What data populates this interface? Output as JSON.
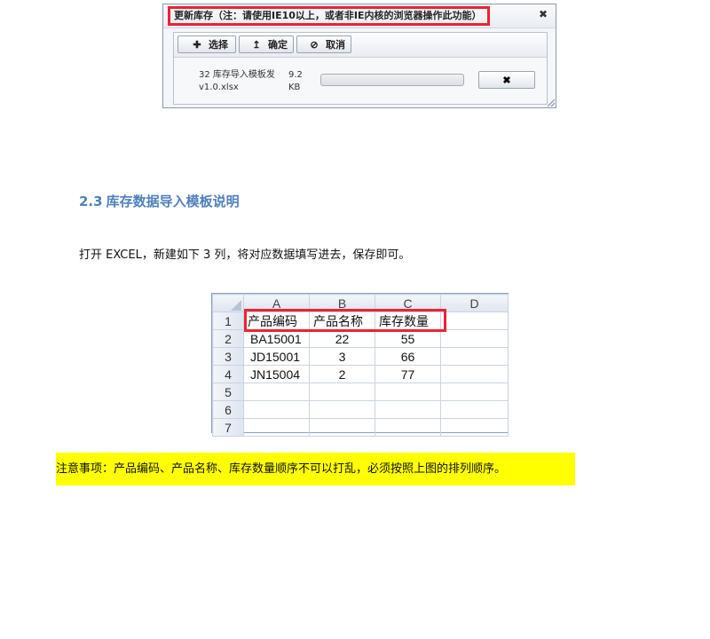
{
  "dialog": {
    "title": "更新库存（注：请使用IE10以上，或者非IE内核的浏览器操作此功能）",
    "close_icon": "close-icon",
    "close_glyph": "✖",
    "toolbar": {
      "select_label": "选择",
      "select_icon": "plus-icon",
      "select_glyph": "✚",
      "confirm_label": "确定",
      "confirm_icon": "upload-icon",
      "confirm_glyph": "↥",
      "cancel_label": "取消",
      "cancel_icon": "cancel-icon",
      "cancel_glyph": "⊘"
    },
    "file": {
      "name": "32 库存导入模板发v1.0.xlsx",
      "size": "9.2 KB",
      "progress": 0,
      "remove_icon": "close-icon",
      "remove_glyph": "✖"
    }
  },
  "section": {
    "number": "2.3",
    "title": "库存数据导入模板说明"
  },
  "instruction": "打开 EXCEL，新建如下 3 列，将对应数据填写进去，保存即可。",
  "spreadsheet": {
    "columns": [
      "A",
      "B",
      "C",
      "D"
    ],
    "rows": [
      {
        "num": "1",
        "cells": [
          "产品编码",
          "产品名称",
          "库存数量",
          ""
        ]
      },
      {
        "num": "2",
        "cells": [
          "BA15001",
          "22",
          "55",
          ""
        ]
      },
      {
        "num": "3",
        "cells": [
          "JD15001",
          "3",
          "66",
          ""
        ]
      },
      {
        "num": "4",
        "cells": [
          "JN15004",
          "2",
          "77",
          ""
        ]
      },
      {
        "num": "5",
        "cells": [
          "",
          "",
          "",
          ""
        ]
      },
      {
        "num": "6",
        "cells": [
          "",
          "",
          "",
          ""
        ]
      },
      {
        "num": "7",
        "cells": [
          "",
          "",
          "",
          ""
        ]
      }
    ]
  },
  "note": "注意事项：产品编码、产品名称、库存数量顺序不可以打乱，必须按照上图的排列顺序。",
  "colors": {
    "highlight_border": "#ee2233",
    "heading": "#4f81bd",
    "note_background": "#ffff00"
  }
}
